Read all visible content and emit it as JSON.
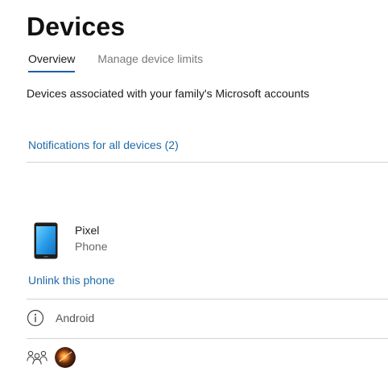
{
  "header": {
    "title": "Devices"
  },
  "tabs": [
    {
      "label": "Overview",
      "active": true
    },
    {
      "label": "Manage device limits",
      "active": false
    }
  ],
  "main": {
    "subtitle": "Devices associated with your family's Microsoft accounts",
    "notifications_link": "Notifications for all devices (2)"
  },
  "device": {
    "name": "Pixel",
    "type": "Phone",
    "icon": "phone-icon",
    "unlink_label": "Unlink this phone",
    "os": "Android",
    "os_icon": "info-icon",
    "users_icon": "people-icon"
  },
  "colors": {
    "accent": "#1a5fa8",
    "link": "#1f6aa8",
    "divider": "#d2d2d2"
  }
}
